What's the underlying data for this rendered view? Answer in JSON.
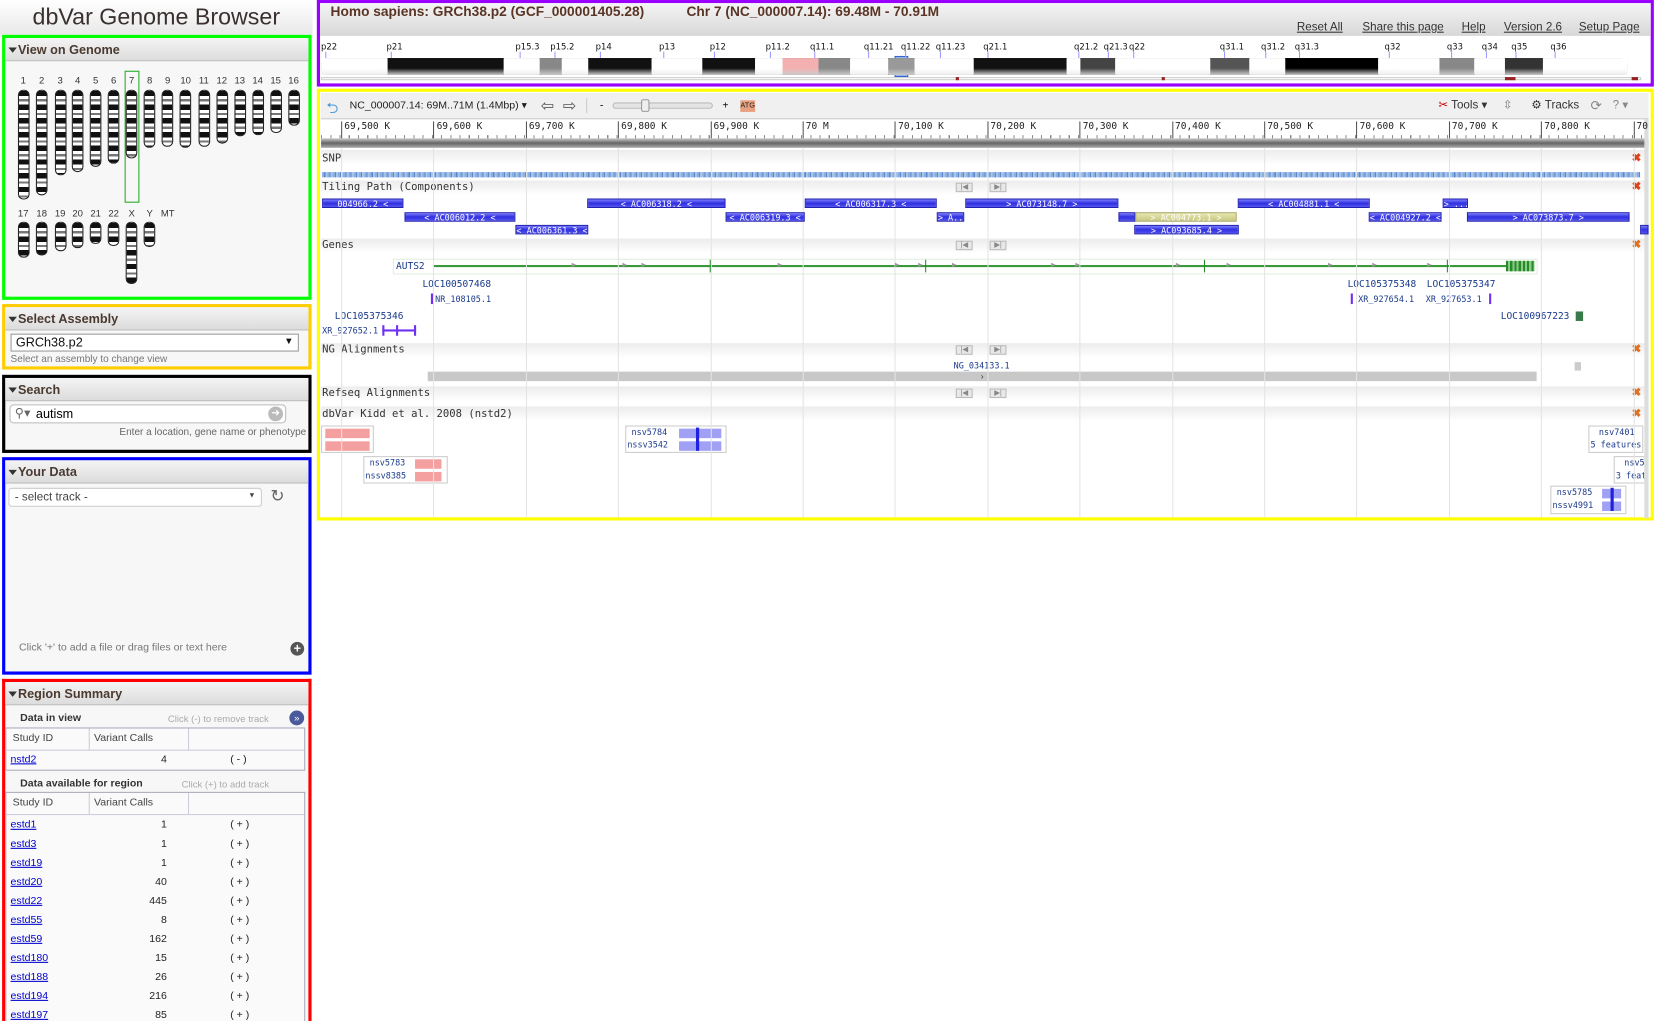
{
  "app": {
    "title": "dbVar Genome Browser"
  },
  "header": {
    "title": "Homo sapiens: GRCh38.p2 (GCF_000001405.28)",
    "location": "Chr 7 (NC_000007.14): 69.48M - 70.91M",
    "links": [
      "Reset All",
      "Share this page",
      "Help",
      "Version 2.6",
      "Setup Page"
    ],
    "bands": [
      "p22",
      "p21",
      "p15.3",
      "p15.2",
      "p14",
      "p13",
      "p12",
      "p11.2",
      "q11.1",
      "q11.21",
      "q11.22",
      "q11.23",
      "q21.1",
      "q21.2",
      "q21.3",
      "q22",
      "q31.1",
      "q31.2",
      "q31.3",
      "q32",
      "q33",
      "q34",
      "q35",
      "q36"
    ]
  },
  "genome": {
    "title": "View on Genome",
    "selected": "7",
    "row1": [
      "1",
      "2",
      "3",
      "4",
      "5",
      "6",
      "7",
      "8",
      "9",
      "10",
      "11",
      "12",
      "13",
      "14",
      "15",
      "16"
    ],
    "row2": [
      "17",
      "18",
      "19",
      "20",
      "21",
      "22",
      "X",
      "Y",
      "MT"
    ]
  },
  "assembly": {
    "title": "Select Assembly",
    "value": "GRCh38.p2",
    "hint": "Select an assembly to change view"
  },
  "search": {
    "title": "Search",
    "value": "autism",
    "hint": "Enter a location, gene name or phenotype"
  },
  "your_data": {
    "title": "Your Data",
    "select": "- select track -",
    "hint": "Click '+' to add a file or drag files or text here"
  },
  "region_summary": {
    "title": "Region Summary",
    "in_view": {
      "title": "Data in view",
      "hint": "Click (-) to remove track",
      "headers": [
        "Study ID",
        "Variant Calls"
      ],
      "rows": [
        {
          "id": "nstd2",
          "calls": "4",
          "action": "( - )"
        }
      ]
    },
    "available": {
      "title": "Data available for region",
      "hint": "Click (+) to add track",
      "headers": [
        "Study ID",
        "Variant Calls"
      ],
      "rows": [
        {
          "id": "estd1",
          "calls": "1",
          "action": "( + )"
        },
        {
          "id": "estd3",
          "calls": "1",
          "action": "( + )"
        },
        {
          "id": "estd19",
          "calls": "1",
          "action": "( + )"
        },
        {
          "id": "estd20",
          "calls": "40",
          "action": "( + )"
        },
        {
          "id": "estd22",
          "calls": "445",
          "action": "( + )"
        },
        {
          "id": "estd55",
          "calls": "8",
          "action": "( + )"
        },
        {
          "id": "estd59",
          "calls": "162",
          "action": "( + )"
        },
        {
          "id": "estd180",
          "calls": "15",
          "action": "( + )"
        },
        {
          "id": "estd188",
          "calls": "26",
          "action": "( + )"
        },
        {
          "id": "estd194",
          "calls": "216",
          "action": "( + )"
        },
        {
          "id": "estd197",
          "calls": "85",
          "action": "( + )"
        }
      ]
    }
  },
  "viewer": {
    "location": "NC_000007.14: 69M..71M (1.4Mbp)",
    "zoom_minus": "-",
    "zoom_plus": "+",
    "zoom_level": 0.2,
    "tools": "Tools",
    "tracks": "Tracks",
    "ruler": [
      "69,500 K",
      "69,600 K",
      "69,700 K",
      "69,800 K",
      "69,900 K",
      "70 M",
      "70,100 K",
      "70,200 K",
      "70,300 K",
      "70,400 K",
      "70,500 K",
      "70,600 K",
      "70,700 K",
      "70,800 K",
      "70"
    ],
    "track_names": {
      "snp": "SNP",
      "tiling": "Tiling Path (Components)",
      "genes": "Genes",
      "ng": "NG Alignments",
      "refseq": "Refseq Alignments",
      "dbvar": "dbVar Kidd et al. 2008 (nstd2)"
    },
    "tiling": [
      "004966.2 <",
      "< AC006318.2 <",
      "< AC006317.3 <",
      "> AC073148.7 >",
      "< AC004881.1 <",
      "> ...",
      "< AC006012.2 <",
      "< AC006319.3 <",
      "> A...",
      "",
      "> AC004773.1 >",
      "< AC004927.2 <",
      "> AC073873.7 >",
      "",
      "< AC006361.3 <",
      "> AC093685.4 >"
    ],
    "genes": {
      "auts2": "AUTS2",
      "loc1": "LOC100507468",
      "nr1": "NR_108105.1",
      "loc2": "LOC105375346",
      "xr2": "XR_927652.1",
      "loc3": "LOC105375348",
      "xr3": "XR_927654.1",
      "loc4": "LOC105375347",
      "xr4": "XR_927653.1",
      "loc5": "LOC100967223"
    },
    "ng": "NG_034133.1",
    "variants": {
      "v1": "nsv5784",
      "v1b": "nssv3542",
      "v2": "nsv5783",
      "v2b": "nssv8385",
      "v3": "nsv7401",
      "v3b": "5 features",
      "v4": "nsv5",
      "v4b": "3 feat",
      "v5": "nsv5785",
      "v5b": "nssv4991"
    },
    "colors": {
      "deletion": "#f4a0a0",
      "gain": "#a0a0f4",
      "gene": "#3a9a3a",
      "component": "#3030e0"
    }
  }
}
